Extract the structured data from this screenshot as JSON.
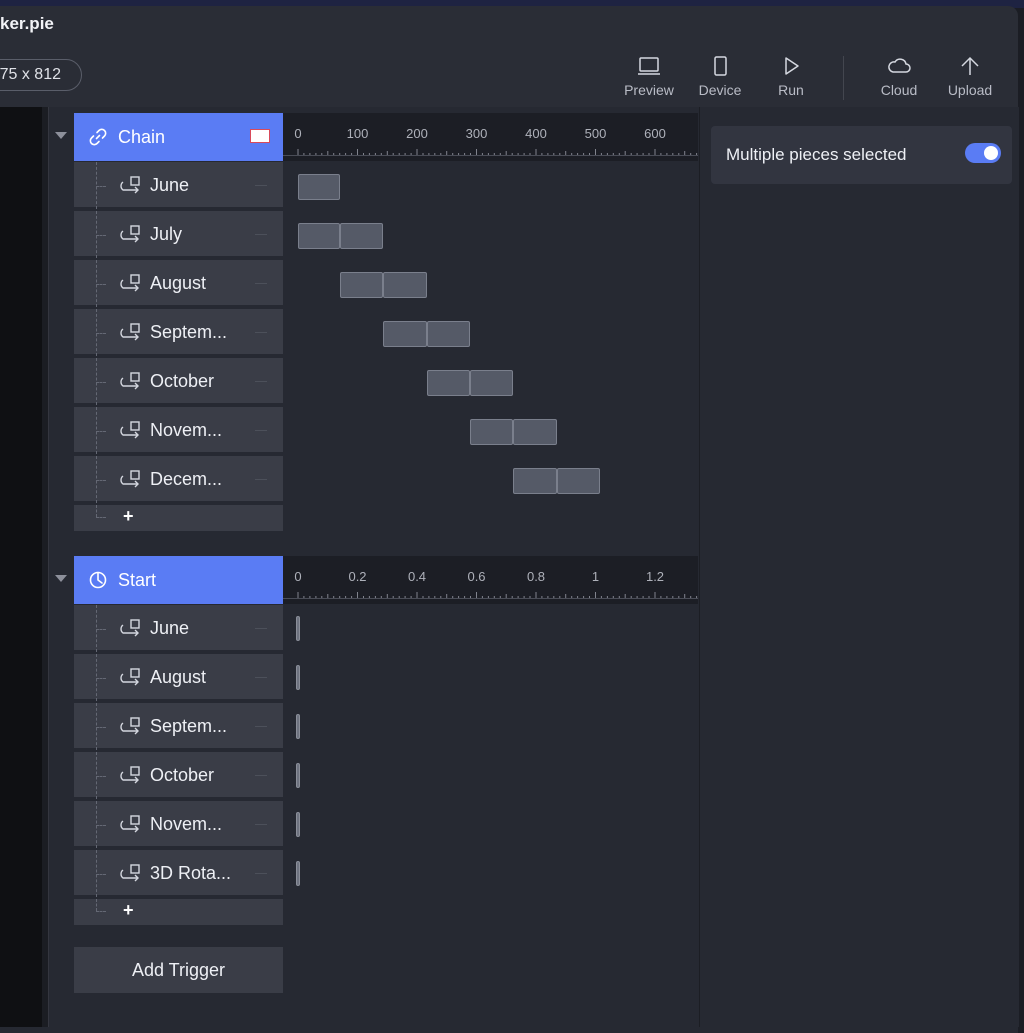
{
  "window": {
    "title": "ker.pie"
  },
  "toolbar": {
    "size_label": "75 x 812",
    "buttons": [
      {
        "label": "Preview",
        "icon": "laptop-icon"
      },
      {
        "label": "Device",
        "icon": "phone-icon"
      },
      {
        "label": "Run",
        "icon": "play-icon"
      },
      {
        "label": "Cloud",
        "icon": "cloud-icon"
      },
      {
        "label": "Upload",
        "icon": "upload-arrow-icon"
      }
    ]
  },
  "triggers": [
    {
      "name": "Chain",
      "icon": "link-icon",
      "ruler_labels": [
        "0",
        "100",
        "200",
        "300",
        "400",
        "500",
        "600"
      ],
      "rows": [
        {
          "label": "June",
          "blocks": [
            [
              0,
              70
            ]
          ]
        },
        {
          "label": "July",
          "blocks": [
            [
              0,
              70
            ],
            [
              70,
              143
            ]
          ]
        },
        {
          "label": "August",
          "blocks": [
            [
              70,
              143
            ],
            [
              143,
              216
            ]
          ]
        },
        {
          "label": "Septem...",
          "blocks": [
            [
              143,
              216
            ],
            [
              216,
              289
            ]
          ]
        },
        {
          "label": "October",
          "blocks": [
            [
              216,
              289
            ],
            [
              289,
              362
            ]
          ]
        },
        {
          "label": "Novem...",
          "blocks": [
            [
              289,
              362
            ],
            [
              362,
              435
            ]
          ]
        },
        {
          "label": "Decem...",
          "blocks": [
            [
              362,
              435
            ],
            [
              435,
              508
            ]
          ]
        }
      ],
      "add_label": "+"
    },
    {
      "name": "Start",
      "icon": "clock-icon",
      "ruler_labels": [
        "0",
        "0.2",
        "0.4",
        "0.6",
        "0.8",
        "1",
        "1.2"
      ],
      "rows": [
        {
          "label": "June"
        },
        {
          "label": "August"
        },
        {
          "label": "Septem..."
        },
        {
          "label": "October"
        },
        {
          "label": "Novem..."
        },
        {
          "label": "3D Rota..."
        }
      ],
      "add_label": "+"
    }
  ],
  "add_trigger_label": "Add Trigger",
  "inspector": {
    "selection_text": "Multiple pieces selected",
    "toggle_on": true
  },
  "colors": {
    "accent": "#5a7cf4",
    "row_bg": "#3a3d47",
    "block_bg": "#555a67"
  }
}
